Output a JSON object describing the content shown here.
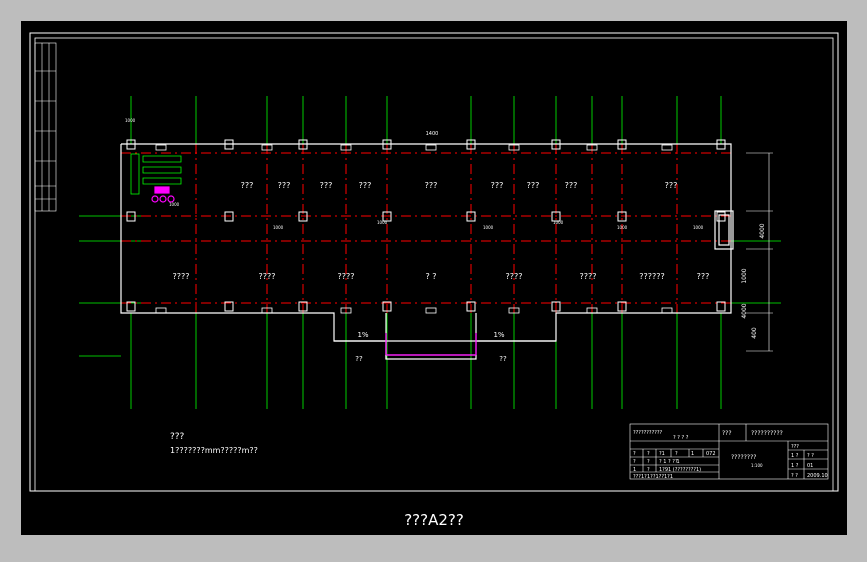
{
  "caption": "???A2??",
  "rooms_top": [
    "???",
    "???",
    "???",
    "???",
    "???",
    "???",
    "???",
    "???",
    "???"
  ],
  "rooms_bottom": [
    "????",
    "????",
    "????",
    "? ?",
    "????",
    "????",
    "??????",
    "???"
  ],
  "entry_labels": [
    "1%",
    "1%",
    "??",
    "??"
  ],
  "notes": {
    "title": "???",
    "body": "1???????mm?????m??"
  },
  "title_block": {
    "company": "???????????",
    "company_sub": "? ? ? ?",
    "field_a": "???",
    "project": "??????????",
    "drawing_name": "????????",
    "scale": "1:100",
    "row1": [
      "?",
      "?",
      "?1",
      "?",
      "1",
      "072"
    ],
    "row2": [
      "?",
      "?",
      "? 1 ? ? 1",
      "?"
    ],
    "row3": [
      "1",
      "?",
      "1?91 (????????1)"
    ],
    "row4": [
      "???1?",
      "1??1??1?1"
    ],
    "right_rows": [
      [
        "???",
        ""
      ],
      [
        "1 ?",
        "? ?"
      ],
      [
        "1 ?",
        "01"
      ],
      [
        "? ?",
        "2009.10"
      ]
    ]
  },
  "dims": [
    "1000",
    "1400",
    "4000",
    "1000",
    "4000",
    "400"
  ],
  "colors": {
    "background": "#000000",
    "frame": "#ffffff",
    "axis": "#ff0000",
    "wall": "#ffffff",
    "grid_line": "#00ff00",
    "furniture": "#00ff00",
    "marker": "#ff00ff",
    "caption": "#ffffff"
  }
}
